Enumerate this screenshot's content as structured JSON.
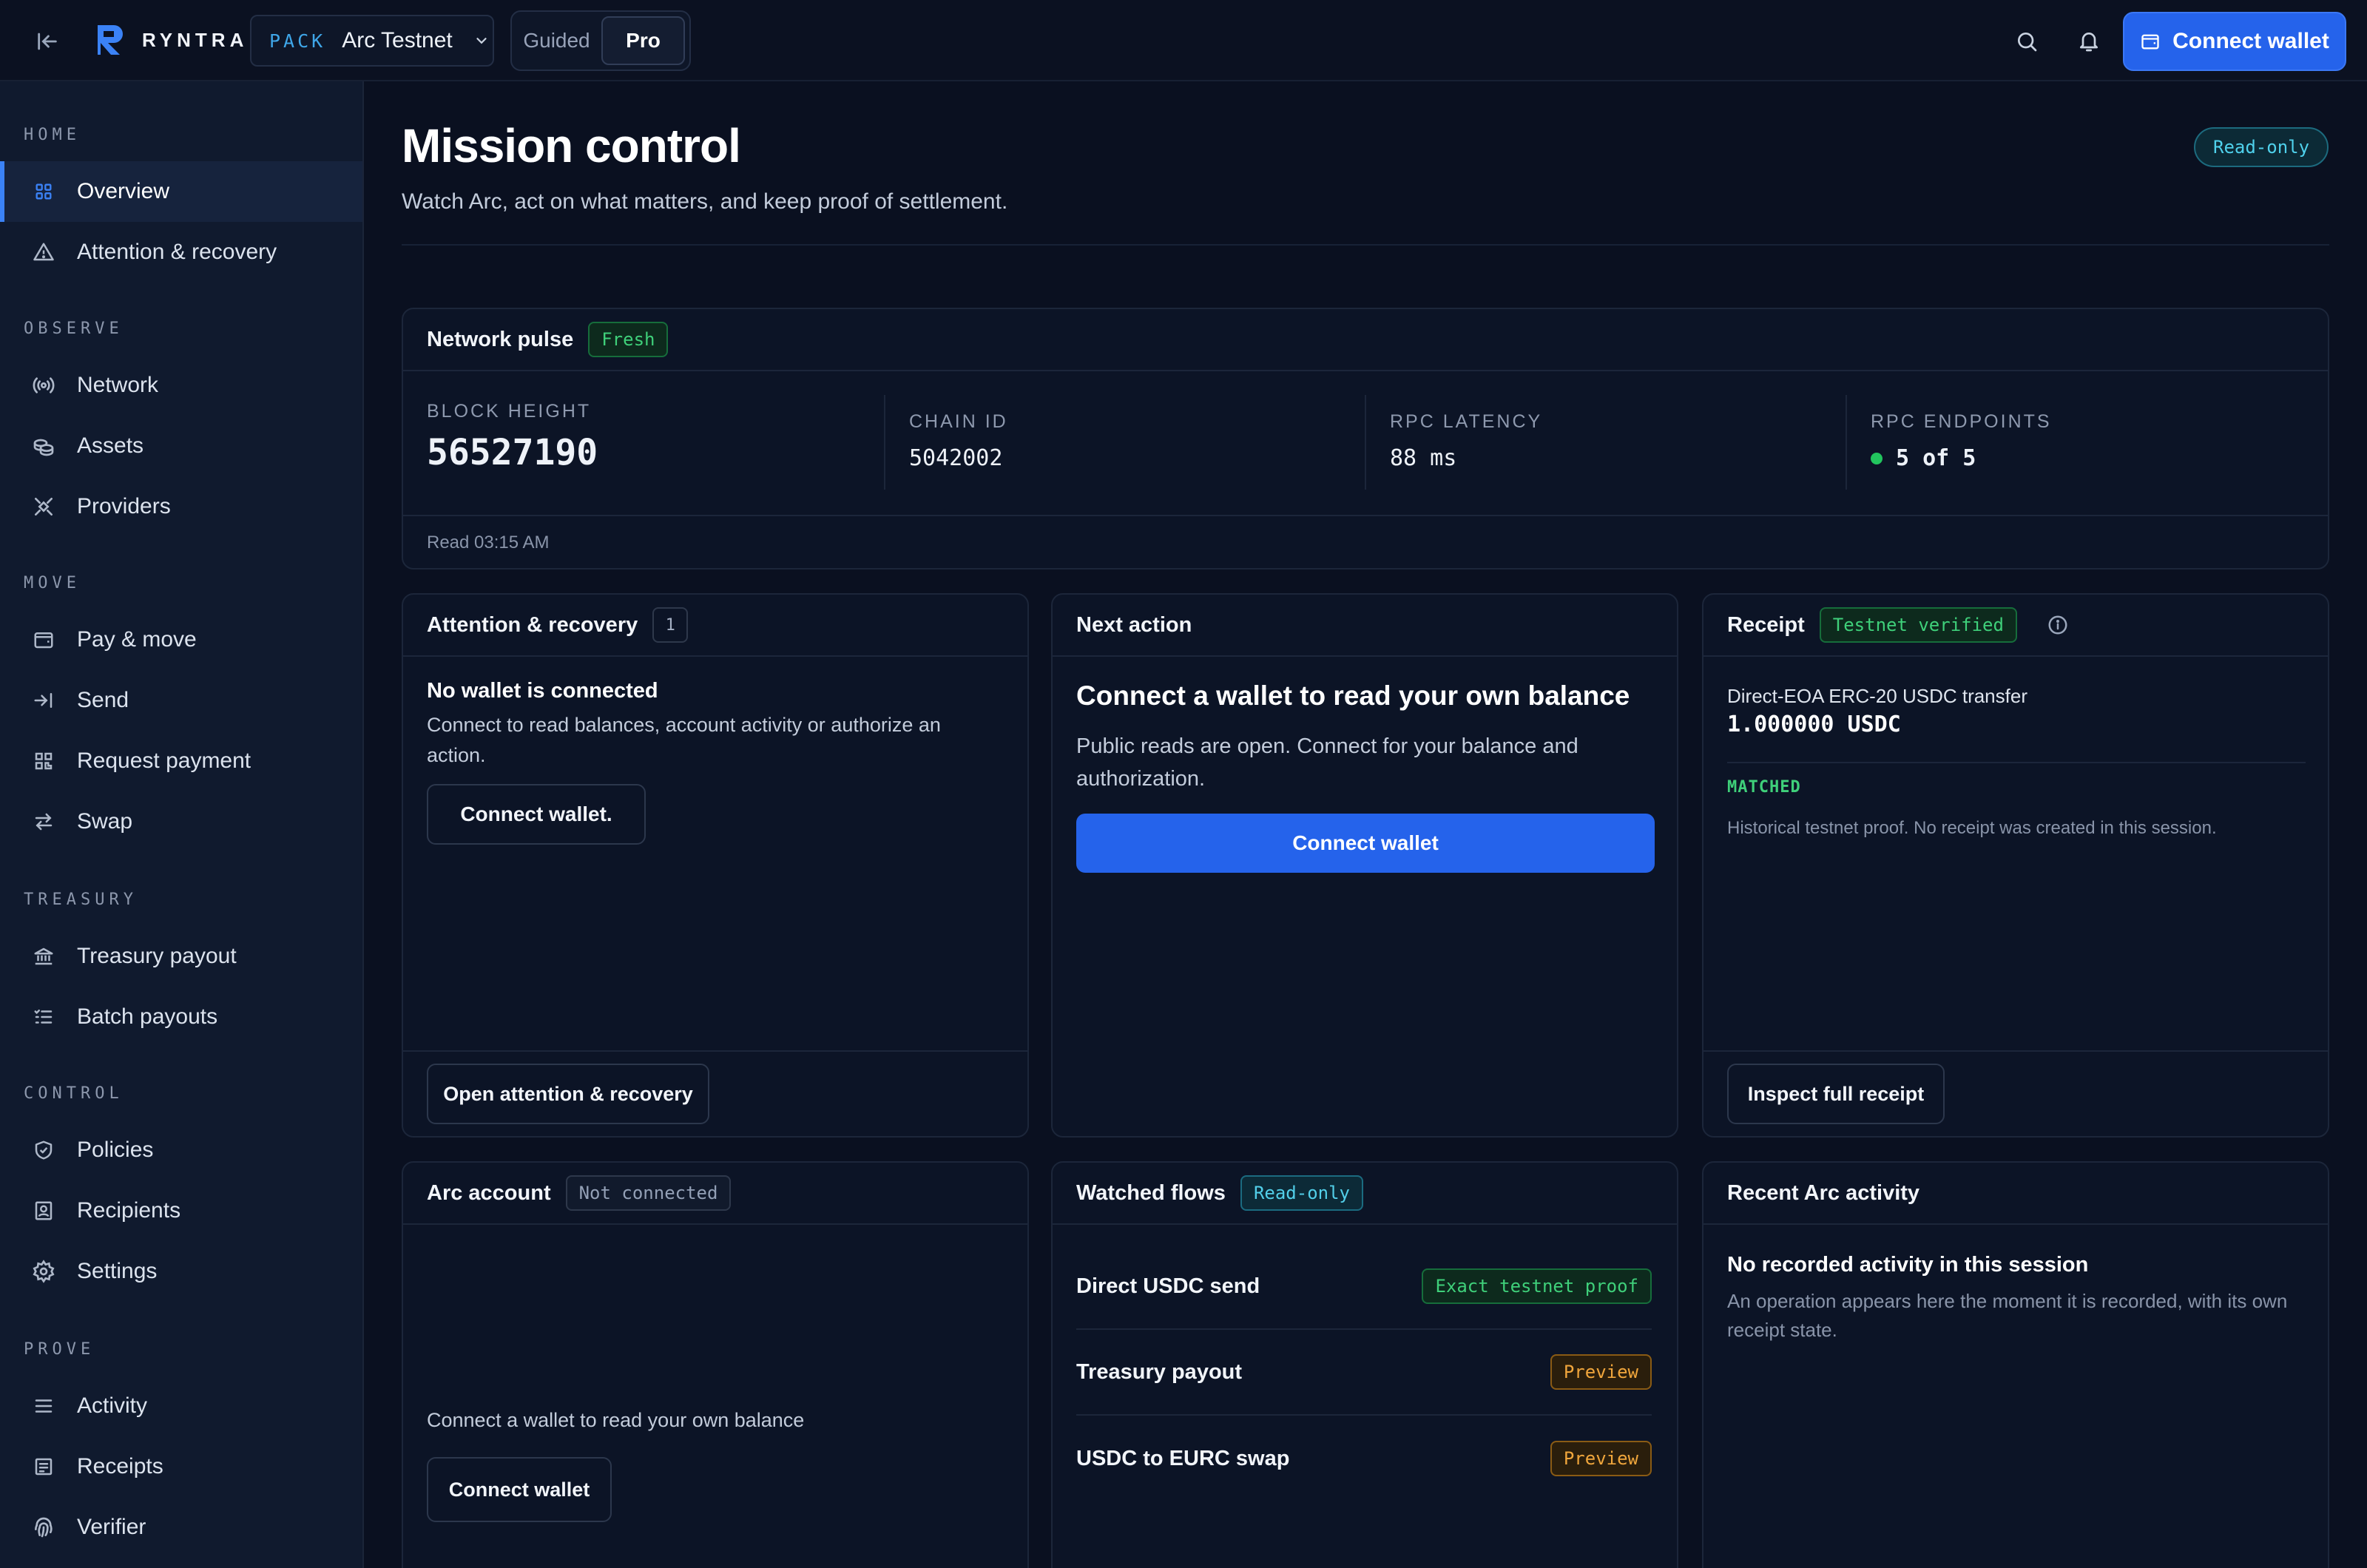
{
  "app": {
    "logo_text": "RYNTRA",
    "pack_label": "PACK",
    "pack_value": "Arc Testnet"
  },
  "mode_toggle": {
    "guided": "Guided",
    "pro": "Pro",
    "selected": "Pro"
  },
  "top_actions": {
    "connect_label": "Connect wallet"
  },
  "sidebar": {
    "sections": [
      {
        "label": "HOME",
        "items": [
          {
            "label": "Overview",
            "icon": "grid-icon",
            "active": true
          },
          {
            "label": "Attention & recovery",
            "icon": "warning-triangle-icon"
          }
        ]
      },
      {
        "label": "OBSERVE",
        "items": [
          {
            "label": "Network",
            "icon": "broadcast-icon"
          },
          {
            "label": "Assets",
            "icon": "coins-icon"
          },
          {
            "label": "Providers",
            "icon": "satellite-icon"
          }
        ]
      },
      {
        "label": "MOVE",
        "items": [
          {
            "label": "Pay & move",
            "icon": "wallet-icon"
          },
          {
            "label": "Send",
            "icon": "arrow-right-bar-icon"
          },
          {
            "label": "Request payment",
            "icon": "qr-icon"
          },
          {
            "label": "Swap",
            "icon": "swap-icon"
          }
        ]
      },
      {
        "label": "TREASURY",
        "items": [
          {
            "label": "Treasury payout",
            "icon": "bank-icon"
          },
          {
            "label": "Batch payouts",
            "icon": "list-check-icon"
          }
        ]
      },
      {
        "label": "CONTROL",
        "items": [
          {
            "label": "Policies",
            "icon": "shield-check-icon"
          },
          {
            "label": "Recipients",
            "icon": "contact-icon"
          },
          {
            "label": "Settings",
            "icon": "gear-icon"
          }
        ]
      },
      {
        "label": "PROVE",
        "items": [
          {
            "label": "Activity",
            "icon": "menu-lines-icon"
          },
          {
            "label": "Receipts",
            "icon": "receipt-icon"
          },
          {
            "label": "Verifier",
            "icon": "fingerprint-icon"
          }
        ]
      }
    ]
  },
  "page": {
    "title": "Mission control",
    "subtitle": "Watch Arc, act on what matters, and keep proof of settlement.",
    "badge": "Read-only"
  },
  "network_pulse": {
    "title": "Network pulse",
    "status": "Fresh",
    "metrics": [
      {
        "label": "BLOCK HEIGHT",
        "value": "56527190"
      },
      {
        "label": "CHAIN ID",
        "value": "5042002"
      },
      {
        "label": "RPC LATENCY",
        "value": "88 ms"
      },
      {
        "label": "RPC ENDPOINTS",
        "value": "5 of 5"
      }
    ],
    "read_time": "Read 03:15 AM"
  },
  "attention": {
    "title": "Attention & recovery",
    "count": "1",
    "heading": "No wallet is connected",
    "body": "Connect to read balances, account activity or authorize an action.",
    "action": "Connect wallet.",
    "footer_action": "Open attention & recovery"
  },
  "next_action": {
    "title": "Next action",
    "heading": "Connect a wallet to read your own balance",
    "body": "Public reads are open. Connect for your balance and authorization.",
    "action": "Connect wallet"
  },
  "receipt": {
    "title": "Receipt",
    "badge": "Testnet verified",
    "transfer_type": "Direct-EOA ERC-20 USDC transfer",
    "amount": "1.000000 USDC",
    "status": "MATCHED",
    "note": "Historical testnet proof. No receipt was created in this session.",
    "footer_action": "Inspect full receipt"
  },
  "arc_account": {
    "title": "Arc account",
    "badge": "Not connected",
    "body": "Connect a wallet to read your own balance",
    "action": "Connect wallet"
  },
  "watched_flows": {
    "title": "Watched flows",
    "badge": "Read-only",
    "rows": [
      {
        "name": "Direct USDC send",
        "status": "Exact testnet proof",
        "tone": "green"
      },
      {
        "name": "Treasury payout",
        "status": "Preview",
        "tone": "amber"
      },
      {
        "name": "USDC to EURC swap",
        "status": "Preview",
        "tone": "amber"
      }
    ]
  },
  "recent_activity": {
    "title": "Recent Arc activity",
    "heading": "No recorded activity in this session",
    "body": "An operation appears here the moment it is recorded, with its own receipt state."
  },
  "colors": {
    "accent": "#2563eb",
    "success": "#22c55e",
    "info": "#4fd1ec",
    "warning": "#f0a63c",
    "background": "#0a1020"
  }
}
